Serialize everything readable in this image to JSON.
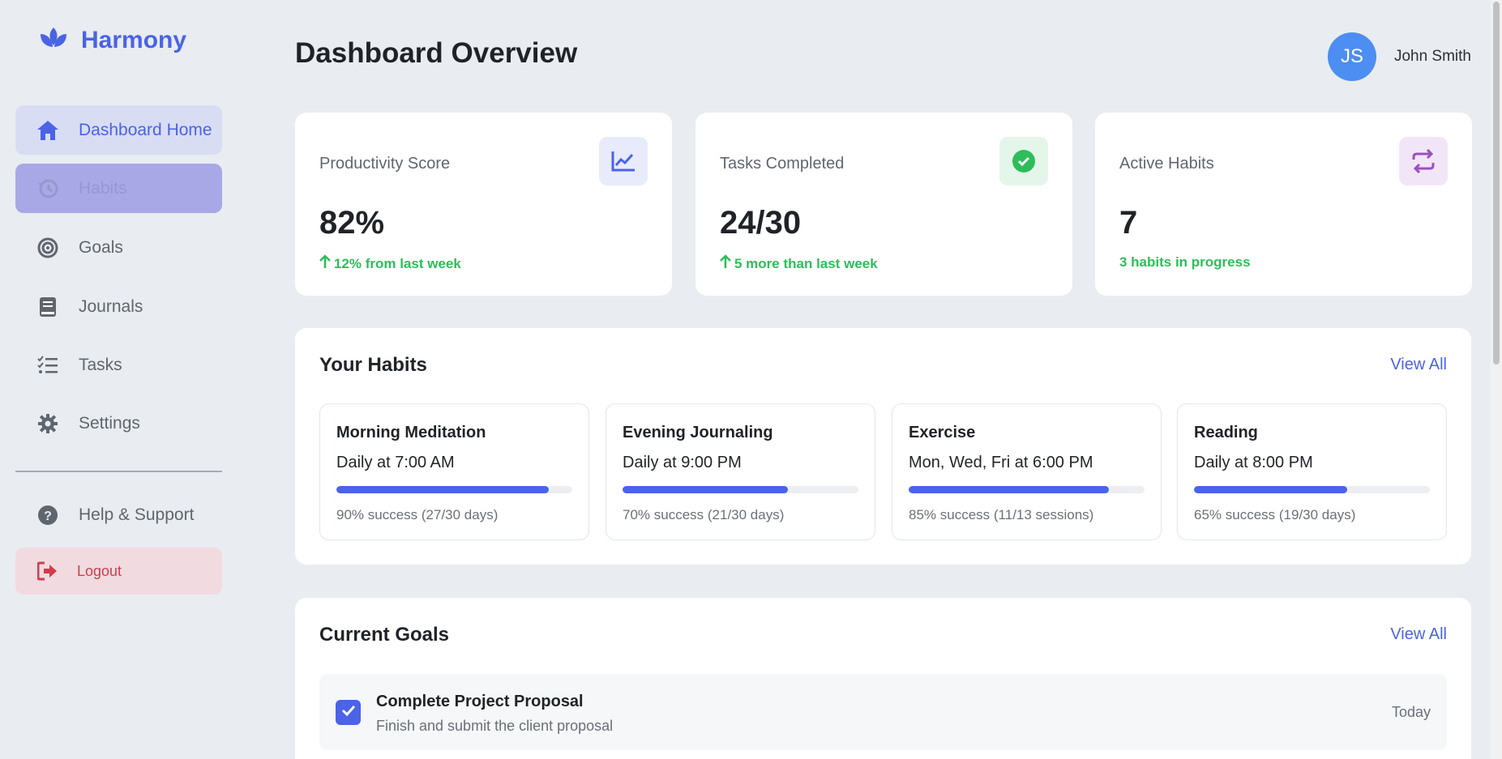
{
  "app": {
    "name": "Harmony"
  },
  "sidebar": {
    "items": [
      {
        "label": "Dashboard Home",
        "icon": "home-icon"
      },
      {
        "label": "Habits",
        "icon": "history-icon"
      },
      {
        "label": "Goals",
        "icon": "target-icon"
      },
      {
        "label": "Journals",
        "icon": "book-icon"
      },
      {
        "label": "Tasks",
        "icon": "checklist-icon"
      },
      {
        "label": "Settings",
        "icon": "gear-icon"
      }
    ],
    "help": {
      "label": "Help & Support",
      "icon": "question-icon"
    },
    "logout": {
      "label": "Logout",
      "icon": "logout-icon"
    }
  },
  "header": {
    "title": "Dashboard Overview",
    "user": {
      "initials": "JS",
      "name": "John Smith"
    }
  },
  "stats": [
    {
      "label": "Productivity Score",
      "value": "82%",
      "sub": "12% from last week",
      "icon": "chart-line-icon",
      "accent": "#4a63e7"
    },
    {
      "label": "Tasks Completed",
      "value": "24/30",
      "sub": "5 more than last week",
      "icon": "check-circle-icon",
      "accent": "#2ebd5a"
    },
    {
      "label": "Active Habits",
      "value": "7",
      "sub": "3 habits in progress",
      "icon": "repeat-icon",
      "accent": "#9b4fc0"
    }
  ],
  "habits_panel": {
    "title": "Your Habits",
    "view_all": "View All",
    "items": [
      {
        "name": "Morning Meditation",
        "schedule": "Daily at 7:00 AM",
        "progress": 0.9,
        "stats": "90% success (27/30 days)"
      },
      {
        "name": "Evening Journaling",
        "schedule": "Daily at 9:00 PM",
        "progress": 0.7,
        "stats": "70% success (21/30 days)"
      },
      {
        "name": "Exercise",
        "schedule": "Mon, Wed, Fri at 6:00 PM",
        "progress": 0.85,
        "stats": "85% success (11/13 sessions)"
      },
      {
        "name": "Reading",
        "schedule": "Daily at 8:00 PM",
        "progress": 0.65,
        "stats": "65% success (19/30 days)"
      }
    ]
  },
  "goals_panel": {
    "title": "Current Goals",
    "view_all": "View All",
    "items": [
      {
        "title": "Complete Project Proposal",
        "description": "Finish and submit the client proposal",
        "due": "Today",
        "checked": true
      }
    ]
  },
  "colors": {
    "accent": "#4a63e7",
    "success": "#2ebd5a",
    "danger": "#d23c4c"
  }
}
